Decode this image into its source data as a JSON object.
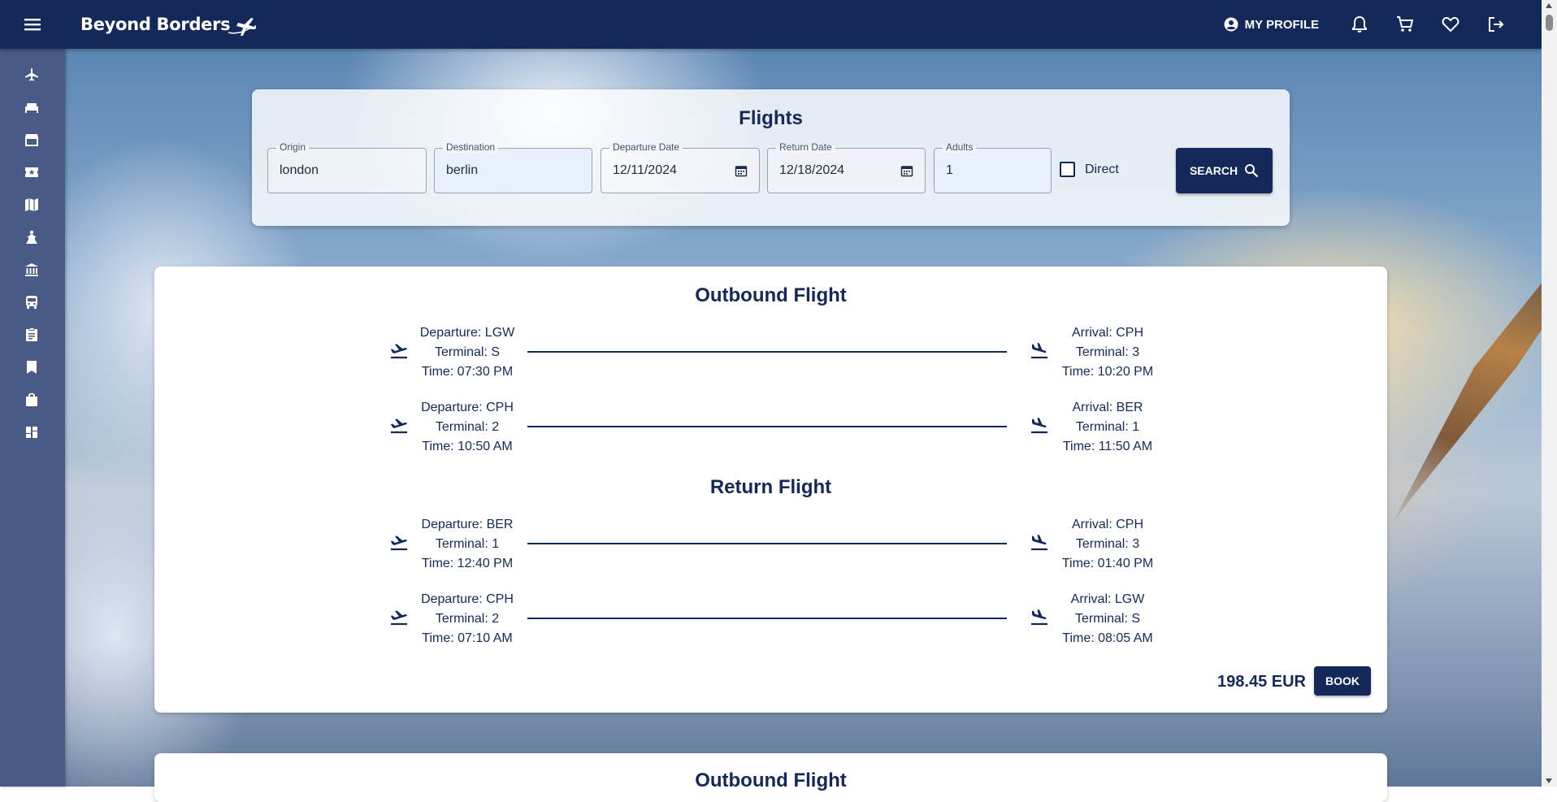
{
  "app": {
    "logo_text": "Beyond Borders"
  },
  "header": {
    "profile_label": "MY PROFILE"
  },
  "search": {
    "title": "Flights",
    "origin": {
      "label": "Origin",
      "value": "london"
    },
    "destination": {
      "label": "Destination",
      "value": "berlin"
    },
    "departure_date": {
      "label": "Departure Date",
      "value": "12/11/2024"
    },
    "return_date": {
      "label": "Return Date",
      "value": "12/18/2024"
    },
    "adults": {
      "label": "Adults",
      "value": "1"
    },
    "direct_label": "Direct",
    "direct_checked": false,
    "search_label": "SEARCH"
  },
  "sidebar": {
    "items": [
      "flight-icon",
      "hotel-icon",
      "store-icon",
      "ticket-icon",
      "map-icon",
      "attraction-icon",
      "museum-icon",
      "bus-icon",
      "clipboard-icon",
      "bookmark-icon",
      "bag-icon",
      "dashboard-icon"
    ]
  },
  "result": {
    "outbound_title": "Outbound Flight",
    "return_title": "Return Flight",
    "outbound": [
      {
        "dep": "Departure: LGW",
        "dep_terminal": "Terminal: S",
        "dep_time": "Time: 07:30 PM",
        "arr": "Arrival: CPH",
        "arr_terminal": "Terminal: 3",
        "arr_time": "Time: 10:20 PM"
      },
      {
        "dep": "Departure: CPH",
        "dep_terminal": "Terminal: 2",
        "dep_time": "Time: 10:50 AM",
        "arr": "Arrival: BER",
        "arr_terminal": "Terminal: 1",
        "arr_time": "Time: 11:50 AM"
      }
    ],
    "return": [
      {
        "dep": "Departure: BER",
        "dep_terminal": "Terminal: 1",
        "dep_time": "Time: 12:40 PM",
        "arr": "Arrival: CPH",
        "arr_terminal": "Terminal: 3",
        "arr_time": "Time: 01:40 PM"
      },
      {
        "dep": "Departure: CPH",
        "dep_terminal": "Terminal: 2",
        "dep_time": "Time: 07:10 AM",
        "arr": "Arrival: LGW",
        "arr_terminal": "Terminal: S",
        "arr_time": "Time: 08:05 AM"
      }
    ],
    "price": "198.45 EUR",
    "book_label": "BOOK"
  },
  "next_result": {
    "outbound_title": "Outbound Flight"
  },
  "colors": {
    "primary": "#14295a",
    "sidebar": "#4a5a87"
  }
}
